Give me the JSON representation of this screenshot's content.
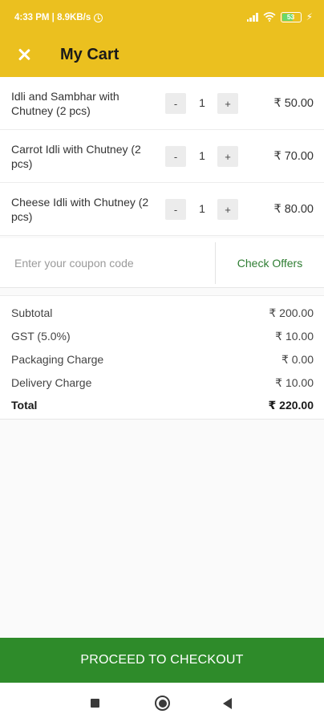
{
  "status_bar": {
    "time_speed": "4:33 PM | 8.9KB/s",
    "battery_level": "53",
    "icons": [
      "alarm-icon",
      "signal-icon",
      "wifi-icon",
      "battery-icon",
      "charging-icon"
    ]
  },
  "app_bar": {
    "title": "My Cart",
    "close_icon": "close-icon",
    "background_color": "#ebc01f"
  },
  "cart_items": [
    {
      "name": "Idli and Sambhar with Chutney (2 pcs)",
      "minus_label": "-",
      "quantity": "1",
      "plus_label": "+",
      "price": "₹ 50.00"
    },
    {
      "name": "Carrot Idli with Chutney (2 pcs)",
      "minus_label": "-",
      "quantity": "1",
      "plus_label": "+",
      "price": "₹ 70.00"
    },
    {
      "name": "Cheese Idli with Chutney (2 pcs)",
      "minus_label": "-",
      "quantity": "1",
      "plus_label": "+",
      "price": "₹ 80.00"
    }
  ],
  "coupon": {
    "placeholder": "Enter your coupon code",
    "value": "",
    "check_offers_label": "Check Offers",
    "accent_color": "#2e7d32"
  },
  "summary": {
    "subtotal_label": "Subtotal",
    "subtotal_value": "₹ 200.00",
    "gst_label": "GST (5.0%)",
    "gst_value": "₹ 10.00",
    "packaging_label": "Packaging Charge",
    "packaging_value": "₹ 0.00",
    "delivery_label": "Delivery Charge",
    "delivery_value": "₹ 10.00",
    "total_label": "Total",
    "total_value": "₹ 220.00"
  },
  "checkout": {
    "label": "PROCEED TO CHECKOUT",
    "color": "#2e8b2a"
  },
  "nav_bar": {
    "icons": [
      "recents-square-icon",
      "home-circle-icon",
      "back-triangle-icon"
    ]
  }
}
